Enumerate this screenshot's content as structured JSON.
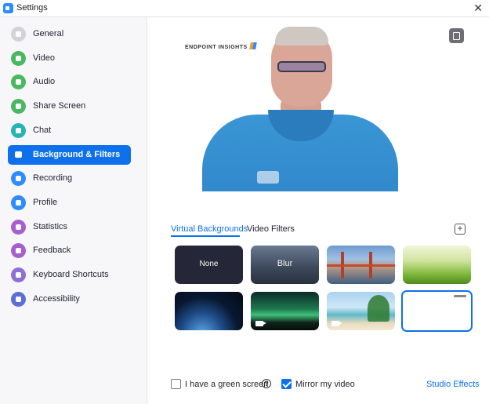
{
  "window": {
    "title": "Settings",
    "close_glyph": "✕"
  },
  "sidebar": {
    "items": [
      {
        "label": "General",
        "icon": "gear-icon",
        "color": "#d2d2d8"
      },
      {
        "label": "Video",
        "icon": "video-icon",
        "color": "#4ab860"
      },
      {
        "label": "Audio",
        "icon": "headphones-icon",
        "color": "#4ab860"
      },
      {
        "label": "Share Screen",
        "icon": "share-screen-icon",
        "color": "#4ab860"
      },
      {
        "label": "Chat",
        "icon": "chat-icon",
        "color": "#26b5b0"
      },
      {
        "label": "Background & Filters",
        "icon": "background-icon",
        "color": "#0e71eb",
        "active": true
      },
      {
        "label": "Recording",
        "icon": "recording-icon",
        "color": "#2d8cff"
      },
      {
        "label": "Profile",
        "icon": "profile-icon",
        "color": "#2d8cff"
      },
      {
        "label": "Statistics",
        "icon": "statistics-icon",
        "color": "#a85ecf"
      },
      {
        "label": "Feedback",
        "icon": "feedback-icon",
        "color": "#a85ecf"
      },
      {
        "label": "Keyboard Shortcuts",
        "icon": "keyboard-icon",
        "color": "#8e6fd6"
      },
      {
        "label": "Accessibility",
        "icon": "accessibility-icon",
        "color": "#5b6fd6"
      }
    ]
  },
  "preview": {
    "background_logo_text": "ENDPOINT INSIGHTS"
  },
  "tabs": {
    "virtual_backgrounds": "Virtual Backgrounds",
    "video_filters": "Video Filters",
    "add_glyph": "+"
  },
  "backgrounds": [
    {
      "label": "None",
      "kind": "none"
    },
    {
      "label": "Blur",
      "kind": "blur"
    },
    {
      "label": "",
      "kind": "gate",
      "name": "golden-gate-thumbnail"
    },
    {
      "label": "",
      "kind": "grass",
      "name": "grass-thumbnail"
    },
    {
      "label": "",
      "kind": "earth",
      "name": "earth-thumbnail"
    },
    {
      "label": "",
      "kind": "aurora",
      "name": "aurora-thumbnail",
      "video": true
    },
    {
      "label": "",
      "kind": "beach",
      "name": "beach-thumbnail",
      "video": true
    },
    {
      "label": "",
      "kind": "white",
      "name": "custom-image-thumbnail",
      "selected": true
    }
  ],
  "footer": {
    "green_screen_label": "I have a green screen",
    "green_screen_checked": false,
    "help_glyph": "?",
    "mirror_label": "Mirror my video",
    "mirror_checked": true,
    "studio_effects_label": "Studio Effects"
  }
}
